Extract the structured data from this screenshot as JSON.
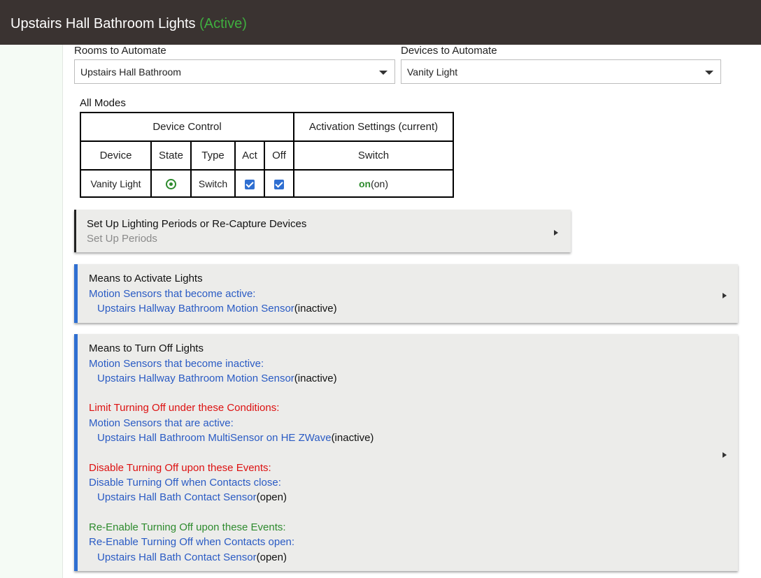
{
  "header": {
    "title": "Upstairs Hall Bathroom Lights",
    "status": "(Active)"
  },
  "rooms": {
    "label": "Rooms to Automate",
    "value": "Upstairs Hall Bathroom"
  },
  "devices": {
    "label": "Devices to Automate",
    "value": "Vanity Light"
  },
  "modes_label": "All Modes",
  "table": {
    "group_device_control": "Device Control",
    "group_activation": "Activation Settings (current)",
    "col_device": "Device",
    "col_state": "State",
    "col_type": "Type",
    "col_act": "Act",
    "col_off": "Off",
    "col_switch": "Switch",
    "row": {
      "device": "Vanity Light",
      "type": "Switch",
      "switch_on": "on",
      "switch_current": "(on)"
    }
  },
  "card_periods": {
    "title": "Set Up Lighting Periods or Re-Capture Devices",
    "subtitle": "Set Up Periods"
  },
  "card_activate": {
    "title": "Means to Activate Lights",
    "sub": "Motion Sensors that become active:",
    "sensor": "Upstairs Hallway Bathroom Motion Sensor",
    "sensor_state": "(inactive)"
  },
  "card_off": {
    "title": "Means to Turn Off Lights",
    "sub1": "Motion Sensors that become inactive:",
    "sensor1": "Upstairs Hallway Bathroom Motion Sensor",
    "sensor1_state": "(inactive)",
    "limit_header": "Limit Turning Off under these Conditions:",
    "sub2": "Motion Sensors that are active:",
    "sensor2": "Upstairs Hall Bathroom MultiSensor on HE ZWave",
    "sensor2_state": "(inactive)",
    "disable_header": "Disable Turning Off upon these Events:",
    "sub3": "Disable Turning Off when Contacts close:",
    "sensor3": "Upstairs Hall Bath Contact Sensor",
    "sensor3_state": "(open)",
    "reenable_header": "Re-Enable Turning Off upon these Events:",
    "sub4": "Re-Enable Turning Off when Contacts open:",
    "sensor4": "Upstairs Hall Bath Contact Sensor",
    "sensor4_state": "(open)"
  }
}
